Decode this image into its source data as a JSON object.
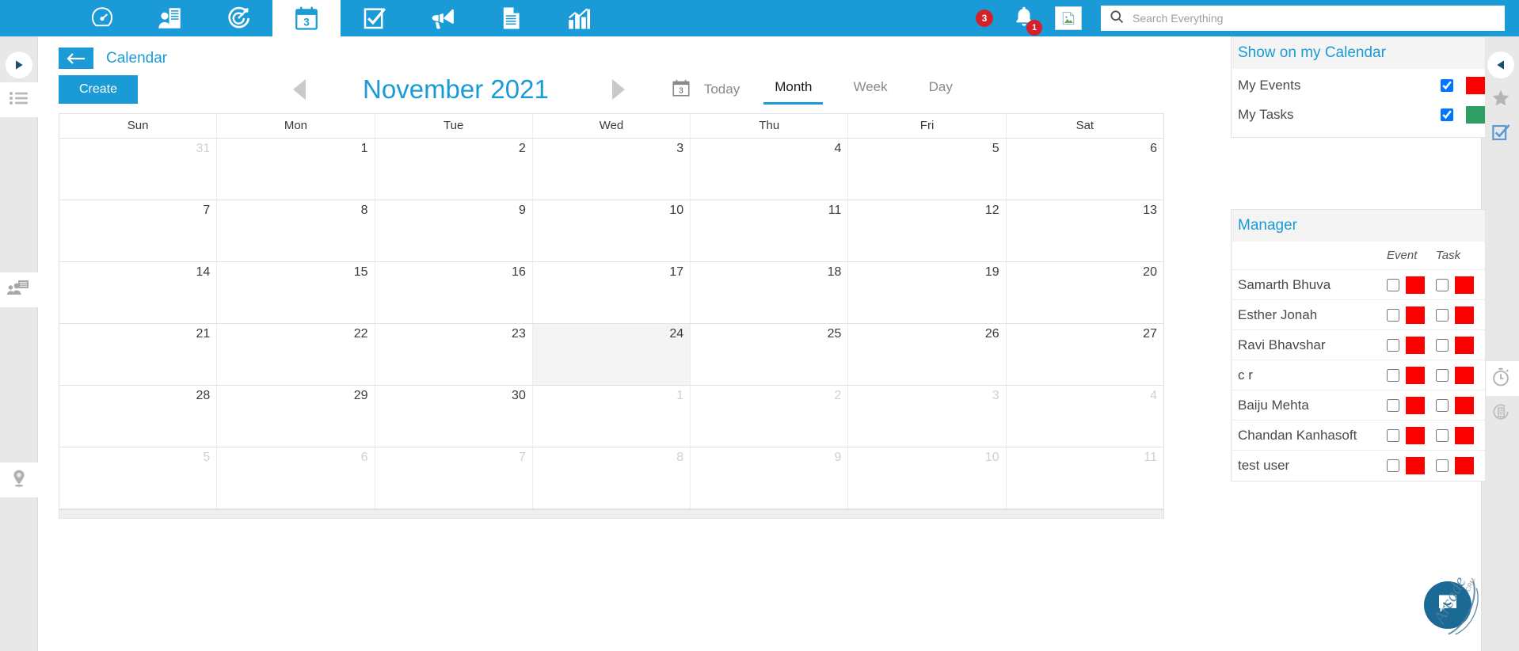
{
  "topnav": {
    "tabs": [
      {
        "name": "dashboard",
        "icon": "gauge-icon",
        "active": false
      },
      {
        "name": "contacts",
        "icon": "person-building-icon",
        "active": false
      },
      {
        "name": "opportunities",
        "icon": "target-arrow-icon",
        "active": false
      },
      {
        "name": "calendar",
        "icon": "calendar-icon",
        "active": true
      },
      {
        "name": "tasks",
        "icon": "checkbox-clipboard-icon",
        "active": false
      },
      {
        "name": "campaigns",
        "icon": "megaphone-icon",
        "active": false
      },
      {
        "name": "documents",
        "icon": "document-icon",
        "active": false
      },
      {
        "name": "reports",
        "icon": "bar-chart-icon",
        "active": false
      }
    ],
    "alert_count": "3",
    "bell_count": "1",
    "search_placeholder": "Search Everything"
  },
  "breadcrumb": {
    "label": "Calendar"
  },
  "toolbar": {
    "create_label": "Create",
    "month_title": "November 2021",
    "today_label": "Today",
    "calendar_icon_day": "3",
    "views": [
      {
        "label": "Month",
        "active": true
      },
      {
        "label": "Week",
        "active": false
      },
      {
        "label": "Day",
        "active": false
      }
    ]
  },
  "calendar": {
    "day_headers": [
      "Sun",
      "Mon",
      "Tue",
      "Wed",
      "Thu",
      "Fri",
      "Sat"
    ],
    "weeks": [
      [
        {
          "d": "31",
          "muted": true
        },
        {
          "d": "1"
        },
        {
          "d": "2"
        },
        {
          "d": "3"
        },
        {
          "d": "4"
        },
        {
          "d": "5"
        },
        {
          "d": "6"
        }
      ],
      [
        {
          "d": "7"
        },
        {
          "d": "8"
        },
        {
          "d": "9"
        },
        {
          "d": "10"
        },
        {
          "d": "11"
        },
        {
          "d": "12"
        },
        {
          "d": "13"
        }
      ],
      [
        {
          "d": "14"
        },
        {
          "d": "15"
        },
        {
          "d": "16"
        },
        {
          "d": "17"
        },
        {
          "d": "18"
        },
        {
          "d": "19"
        },
        {
          "d": "20"
        }
      ],
      [
        {
          "d": "21"
        },
        {
          "d": "22"
        },
        {
          "d": "23"
        },
        {
          "d": "24",
          "today": true
        },
        {
          "d": "25"
        },
        {
          "d": "26"
        },
        {
          "d": "27"
        }
      ],
      [
        {
          "d": "28"
        },
        {
          "d": "29"
        },
        {
          "d": "30"
        },
        {
          "d": "1",
          "muted": true
        },
        {
          "d": "2",
          "muted": true
        },
        {
          "d": "3",
          "muted": true
        },
        {
          "d": "4",
          "muted": true
        }
      ],
      [
        {
          "d": "5",
          "muted": true
        },
        {
          "d": "6",
          "muted": true
        },
        {
          "d": "7",
          "muted": true
        },
        {
          "d": "8",
          "muted": true
        },
        {
          "d": "9",
          "muted": true
        },
        {
          "d": "10",
          "muted": true
        },
        {
          "d": "11",
          "muted": true
        }
      ]
    ]
  },
  "show_panel": {
    "title": "Show on my Calendar",
    "rows": [
      {
        "label": "My Events",
        "checked": true,
        "color": "#fd0000"
      },
      {
        "label": "My Tasks",
        "checked": true,
        "color": "#2e9e62"
      }
    ]
  },
  "manager_panel": {
    "title": "Manager",
    "col_event": "Event",
    "col_task": "Task",
    "rows": [
      {
        "name": "Samarth Bhuva",
        "event_checked": false,
        "event_color": "#fd0000",
        "task_checked": false,
        "task_color": "#fd0000"
      },
      {
        "name": "Esther Jonah",
        "event_checked": false,
        "event_color": "#fd0000",
        "task_checked": false,
        "task_color": "#fd0000"
      },
      {
        "name": "Ravi Bhavshar",
        "event_checked": false,
        "event_color": "#fd0000",
        "task_checked": false,
        "task_color": "#fd0000"
      },
      {
        "name": "c r",
        "event_checked": false,
        "event_color": "#fd0000",
        "task_checked": false,
        "task_color": "#fd0000"
      },
      {
        "name": "Baiju Mehta",
        "event_checked": false,
        "event_color": "#fd0000",
        "task_checked": false,
        "task_color": "#fd0000"
      },
      {
        "name": "Chandan Kanhasoft",
        "event_checked": false,
        "event_color": "#fd0000",
        "task_checked": false,
        "task_color": "#fd0000"
      },
      {
        "name": "test user",
        "event_checked": false,
        "event_color": "#fd0000",
        "task_checked": false,
        "task_color": "#fd0000"
      }
    ]
  },
  "left_rail": {
    "items": [
      {
        "name": "play-icon"
      },
      {
        "name": "list-icon"
      },
      {
        "name": "meeting-people-icon"
      },
      {
        "name": "location-pin-icon"
      }
    ]
  },
  "right_rail": {
    "items": [
      {
        "name": "collapse-left-icon"
      },
      {
        "name": "star-icon"
      },
      {
        "name": "checkbox-icon"
      },
      {
        "name": "stopwatch-icon"
      },
      {
        "name": "history-icon"
      }
    ]
  },
  "watermark": {
    "brand": "Arcade",
    "suffix": "CRM"
  },
  "colors": {
    "brand_blue": "#1a9bd7",
    "badge_red": "#d5212a",
    "event_red": "#fd0000",
    "task_green": "#2e9e62",
    "chat_blue": "#1b6a96"
  }
}
